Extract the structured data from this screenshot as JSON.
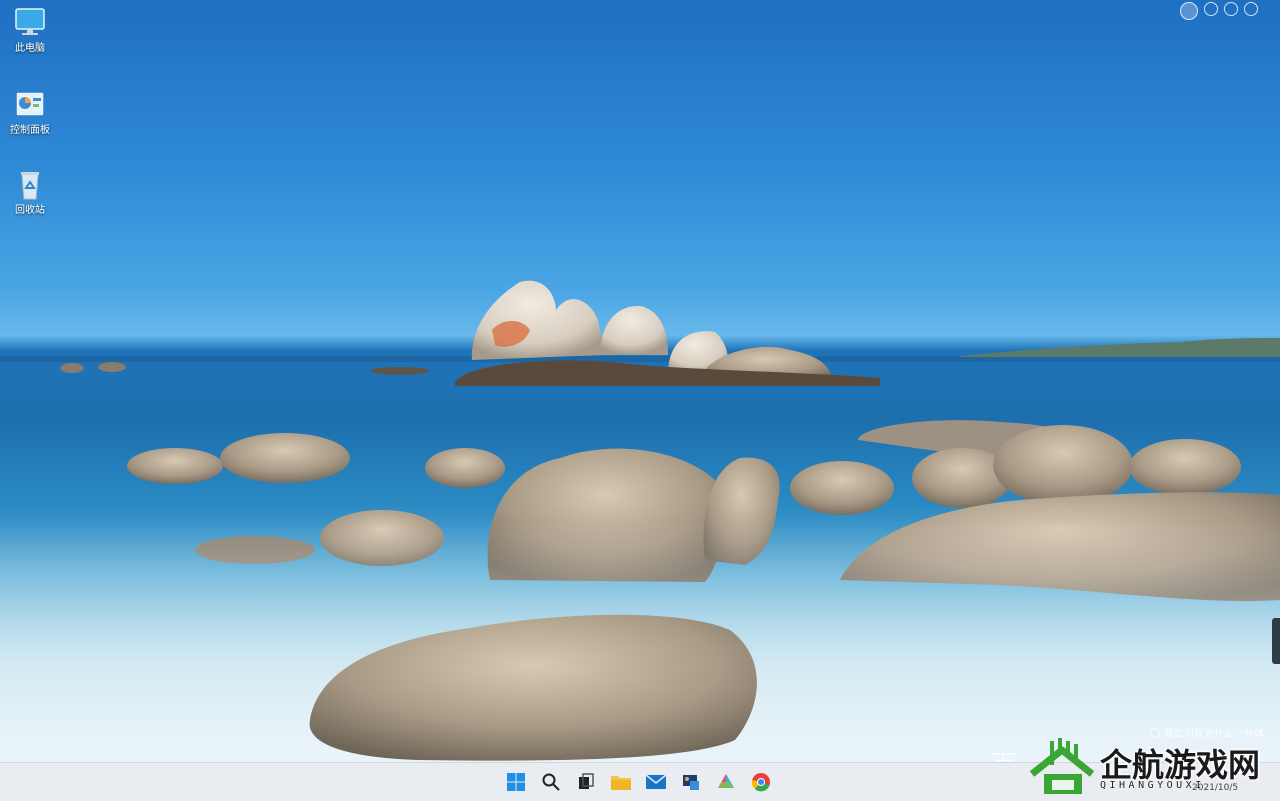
{
  "desktop": {
    "icons": [
      {
        "label": "此电脑",
        "icon": "monitor-icon"
      },
      {
        "label": "控制面板",
        "icon": "control-panel-icon"
      },
      {
        "label": "回收站",
        "icon": "recycle-bin-icon"
      }
    ],
    "notification_text": "要如何冒充什么一种体...",
    "watermark_left": "百"
  },
  "top_right_icons": [
    "assistant-icon",
    "search-circle-icon",
    "pause-icon",
    "weibo-icon"
  ],
  "taskbar": {
    "apps": [
      {
        "name": "Start",
        "icon": "windows-start-icon"
      },
      {
        "name": "Search",
        "icon": "search-icon"
      },
      {
        "name": "Task View",
        "icon": "task-view-icon"
      },
      {
        "name": "File Explorer",
        "icon": "folder-icon"
      },
      {
        "name": "Mail",
        "icon": "mail-icon"
      },
      {
        "name": "Control Panel",
        "icon": "settings-app-icon"
      },
      {
        "name": "Photos",
        "icon": "photos-icon"
      },
      {
        "name": "Chrome",
        "icon": "chrome-icon"
      }
    ],
    "tray_date": "2021/10/5"
  },
  "brand_logo": {
    "name": "企航游戏网",
    "pinyin": "QIHANGYOUXI"
  },
  "colors": {
    "sky": "#2f8ad6",
    "sea": "#1d6fad",
    "taskbar": "#e9edf2",
    "logo_green": "#3aa635"
  }
}
